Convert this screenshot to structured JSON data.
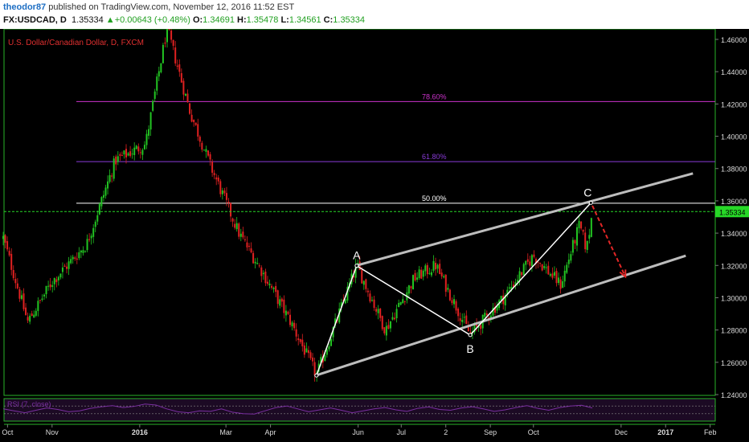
{
  "header": {
    "author": "theodor87",
    "published_text": " published on TradingView.com, November 12, 2016 11:52 EST",
    "symbol": "FX:USDCAD, D",
    "last": "1.35334",
    "change_arrow": "▲",
    "change": "+0.00643 (+0.48%)",
    "open_label": "O:",
    "open": "1.34691",
    "high_label": "H:",
    "high": "1.35478",
    "low_label": "L:",
    "low": "1.34561",
    "close_label": "C:",
    "close": "1.35334"
  },
  "colors": {
    "background": "#000000",
    "frame": "#27b327",
    "up_candle": "#22c422",
    "down_candle": "#e02121",
    "last_price_line": "#27d827",
    "channel": "#bdbdbd",
    "abc": "#ffffff",
    "projection": "#e42626",
    "fib_786": "#cc33cc",
    "fib_618": "#8a3bd8",
    "fib_500": "#ffffff",
    "rsi_line": "#7a2fa0",
    "rsi_fill": "#1c0a24",
    "title": "#e03030",
    "axis_text": "#dddddd"
  },
  "chart_data": {
    "type": "candlestick",
    "title": "U.S. Dollar/Canadian Dollar, D, FXCM",
    "timeframe": "D",
    "x_tick_labels": [
      "Oct",
      "Nov",
      "2016",
      "Mar",
      "Apr",
      "Jun",
      "Jul",
      "2",
      "Sep",
      "Oct",
      "Dec",
      "2017",
      "Feb"
    ],
    "y_tick_labels": [
      "1.46000",
      "1.44000",
      "1.42000",
      "1.40000",
      "1.38000",
      "1.36000",
      "1.34000",
      "1.32000",
      "1.30000",
      "1.28000",
      "1.26000",
      "1.24000"
    ],
    "ylim": [
      1.2395,
      1.4625
    ],
    "last_price": "1.35334",
    "price_path": [
      {
        "date": "2015-09-28",
        "price": 1.337
      },
      {
        "date": "2015-10-15",
        "price": 1.285
      },
      {
        "date": "2015-11-01",
        "price": 1.31
      },
      {
        "date": "2015-11-25",
        "price": 1.333
      },
      {
        "date": "2015-12-15",
        "price": 1.385
      },
      {
        "date": "2016-01-05",
        "price": 1.395
      },
      {
        "date": "2016-01-20",
        "price": 1.467
      },
      {
        "date": "2016-02-05",
        "price": 1.415
      },
      {
        "date": "2016-02-20",
        "price": 1.38
      },
      {
        "date": "2016-03-10",
        "price": 1.34
      },
      {
        "date": "2016-03-25",
        "price": 1.318
      },
      {
        "date": "2016-04-15",
        "price": 1.285
      },
      {
        "date": "2016-05-03",
        "price": 1.252
      },
      {
        "date": "2016-05-31",
        "price": 1.32
      },
      {
        "date": "2016-06-20",
        "price": 1.28
      },
      {
        "date": "2016-07-10",
        "price": 1.312
      },
      {
        "date": "2016-07-25",
        "price": 1.32
      },
      {
        "date": "2016-08-18",
        "price": 1.277
      },
      {
        "date": "2016-09-10",
        "price": 1.3
      },
      {
        "date": "2016-10-01",
        "price": 1.326
      },
      {
        "date": "2016-10-20",
        "price": 1.308
      },
      {
        "date": "2016-11-02",
        "price": 1.345
      },
      {
        "date": "2016-11-07",
        "price": 1.33
      },
      {
        "date": "2016-11-11",
        "price": 1.353
      }
    ],
    "fibonacci_levels": [
      {
        "label": "78.60%",
        "price": 1.4215
      },
      {
        "label": "61.80%",
        "price": 1.3843
      },
      {
        "label": "50.00%",
        "price": 1.3585
      }
    ],
    "abc_pattern": [
      {
        "label": "",
        "date": "2016-05-03",
        "price": 1.2518
      },
      {
        "label": "A",
        "date": "2016-05-31",
        "price": 1.3198
      },
      {
        "label": "B",
        "date": "2016-08-18",
        "price": 1.2769
      },
      {
        "label": "C",
        "date": "2016-11-10",
        "price": 1.3588
      }
    ],
    "channel_lines": [
      {
        "from": {
          "date": "2016-05-31",
          "price": 1.32
        },
        "to": {
          "date": "2017-01-20",
          "price": 1.377
        }
      },
      {
        "from": {
          "date": "2016-05-03",
          "price": 1.252
        },
        "to": {
          "date": "2017-01-15",
          "price": 1.326
        }
      }
    ],
    "projection": {
      "from": {
        "date": "2016-11-11",
        "price": 1.357
      },
      "to": {
        "date": "2016-12-04",
        "price": 1.313
      }
    },
    "rsi": {
      "label": "RSI (7, close)",
      "bands": [
        70,
        30
      ],
      "values": [
        55,
        45,
        35,
        48,
        60,
        52,
        40,
        45,
        58,
        66,
        72,
        62,
        68,
        80,
        75,
        55,
        40,
        35,
        45,
        42,
        55,
        38,
        30,
        28,
        45,
        62,
        70,
        55,
        40,
        50,
        60,
        48,
        35,
        45,
        55,
        62,
        50,
        42,
        58,
        65,
        52,
        48,
        60,
        66,
        55,
        42,
        50,
        62,
        72,
        58,
        48,
        62,
        70,
        74,
        60
      ]
    }
  }
}
